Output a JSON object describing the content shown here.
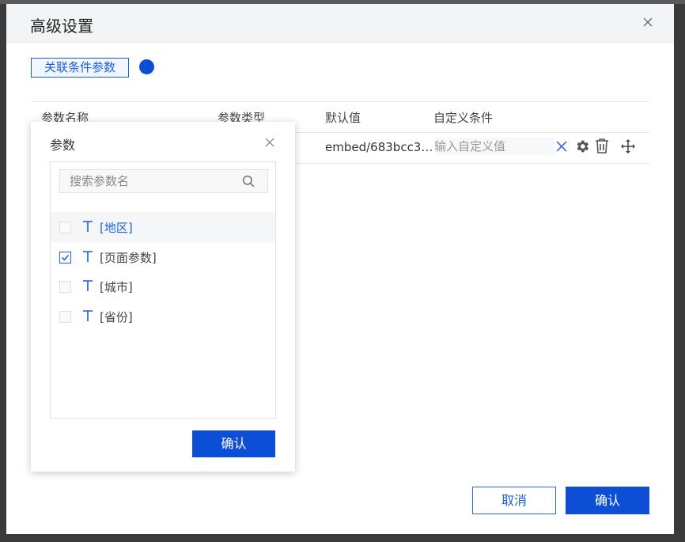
{
  "dialog": {
    "title": "高级设置",
    "link_button_label": "关联条件参数",
    "cancel_label": "取消",
    "confirm_label": "确认"
  },
  "table": {
    "columns": [
      "参数名称",
      "参数类型",
      "默认值",
      "自定义条件"
    ],
    "rows": [
      {
        "default_value": "embed/683bcc32...",
        "custom_placeholder": "输入自定义值"
      }
    ]
  },
  "popover": {
    "title": "参数",
    "search_placeholder": "搜索参数名",
    "items": [
      {
        "label": "[地区]",
        "checked": false,
        "highlighted": true
      },
      {
        "label": "[页面参数]",
        "checked": true,
        "highlighted": false
      },
      {
        "label": "[城市]",
        "checked": false,
        "highlighted": false
      },
      {
        "label": "[省份]",
        "checked": false,
        "highlighted": false
      }
    ],
    "confirm_label": "确认"
  },
  "icons": [
    "close-icon",
    "x-icon",
    "gear-icon",
    "trash-icon",
    "move-icon",
    "search-icon",
    "text-type-icon",
    "checkbox-icon"
  ],
  "colors": {
    "accent": "#0c4fd6",
    "link": "#1c5fd9",
    "header_bg": "#f3f4f6",
    "backdrop": "#3a3a3a"
  }
}
